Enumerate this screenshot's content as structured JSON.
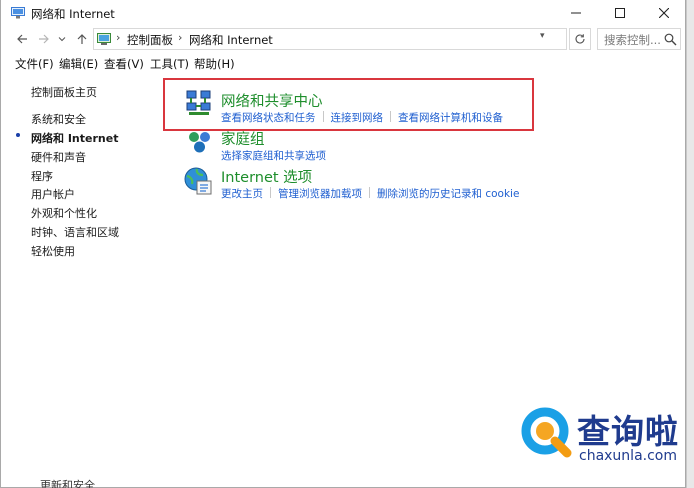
{
  "window": {
    "title": "网络和 Internet",
    "controls": {
      "minimize": "—",
      "maximize": "☐",
      "close": "✕"
    }
  },
  "nav": {
    "back_icon": "arrow-left-icon",
    "forward_icon": "arrow-right-icon",
    "recent_icon": "chevron-down-icon",
    "up_icon": "arrow-up-icon",
    "breadcrumb": [
      "控制面板",
      "网络和 Internet"
    ],
    "refresh_icon": "refresh-icon",
    "search": {
      "placeholder": "搜索控制...",
      "icon": "search-icon"
    }
  },
  "menu": [
    {
      "label": "文件(F)"
    },
    {
      "label": "编辑(E)"
    },
    {
      "label": "查看(V)"
    },
    {
      "label": "工具(T)"
    },
    {
      "label": "帮助(H)"
    }
  ],
  "sidebar": {
    "home": "控制面板主页",
    "items": [
      {
        "label": "系统和安全",
        "current": false
      },
      {
        "label": "网络和 Internet",
        "current": true
      },
      {
        "label": "硬件和声音",
        "current": false
      },
      {
        "label": "程序",
        "current": false
      },
      {
        "label": "用户帐户",
        "current": false
      },
      {
        "label": "外观和个性化",
        "current": false
      },
      {
        "label": "时钟、语言和区域",
        "current": false
      },
      {
        "label": "轻松使用",
        "current": false
      }
    ]
  },
  "categories": [
    {
      "title": "网络和共享中心",
      "icon": "network-sharing-icon",
      "links": [
        "查看网络状态和任务",
        "连接到网络",
        "查看网络计算机和设备"
      ]
    },
    {
      "title": "家庭组",
      "icon": "homegroup-icon",
      "links": [
        "选择家庭组和共享选项"
      ]
    },
    {
      "title": "Internet 选项",
      "icon": "internet-options-icon",
      "links": [
        "更改主页",
        "管理浏览器加载项",
        "删除浏览的历史记录和 cookie"
      ]
    }
  ],
  "watermark": {
    "brand": "查询啦",
    "url": "chaxunla.com",
    "color": "#1f3b8e"
  },
  "background_window_text": "更新和安全",
  "colors": {
    "category_title": "#1e8e2c",
    "link": "#1f5fd0",
    "highlight": "#d9363e"
  }
}
